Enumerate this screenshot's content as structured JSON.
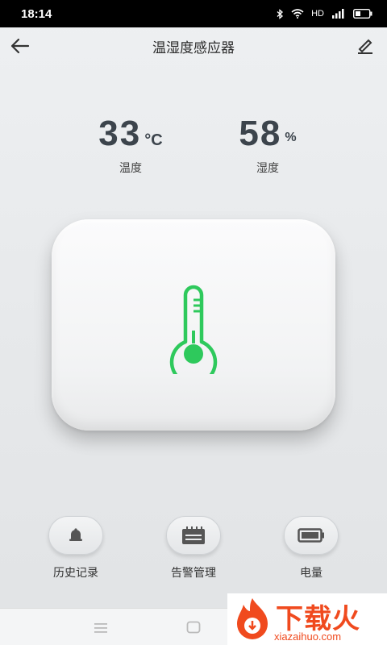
{
  "status_bar": {
    "time": "18:14",
    "network_label": "HD",
    "icons": [
      "bluetooth-icon",
      "wifi-icon",
      "signal-icon",
      "battery-icon"
    ]
  },
  "app_bar": {
    "title": "温湿度感应器",
    "back_icon": "arrow-left-icon",
    "edit_icon": "pencil-icon"
  },
  "readings": {
    "temperature": {
      "value": "33",
      "unit": "°C",
      "label": "温度"
    },
    "humidity": {
      "value": "58",
      "unit": "%",
      "label": "湿度"
    }
  },
  "panel": {
    "icon": "thermometer-icon",
    "accent_color": "#2ec95c"
  },
  "actions": [
    {
      "label": "历史记录",
      "icon": "bell-icon"
    },
    {
      "label": "告警管理",
      "icon": "calendar-icon"
    },
    {
      "label": "电量",
      "icon": "battery-icon"
    }
  ],
  "nav": {
    "icons": [
      "menu-icon",
      "home-icon"
    ]
  },
  "watermark": {
    "text": "下载火",
    "subtext": "xiazaihuo.com"
  },
  "colors": {
    "background": "#e8eaec",
    "value_text": "#3c444c",
    "thermometer": "#2ec95c",
    "watermark": "#f04a1e"
  }
}
